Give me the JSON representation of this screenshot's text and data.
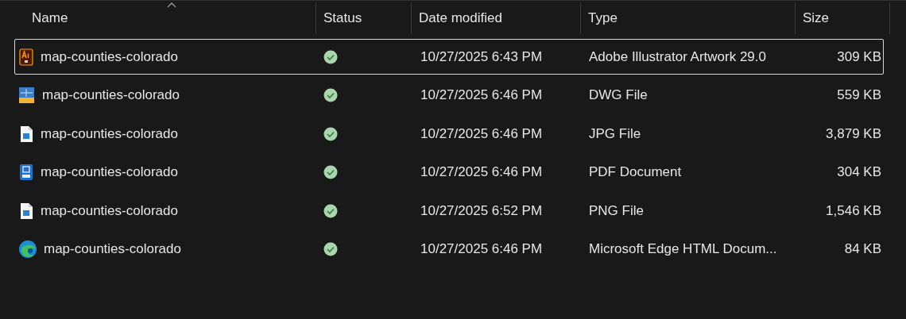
{
  "columns": [
    {
      "label": "Name",
      "sorted": true
    },
    {
      "label": "Status",
      "sorted": false
    },
    {
      "label": "Date modified",
      "sorted": false
    },
    {
      "label": "Type",
      "sorted": false
    },
    {
      "label": "Size",
      "sorted": false
    }
  ],
  "rows": [
    {
      "kind": "ai",
      "name": "map-counties-colorado",
      "synced": true,
      "date": "10/27/2025 6:43 PM",
      "type": "Adobe Illustrator Artwork 29.0",
      "size": "309 KB",
      "selected": true
    },
    {
      "kind": "dwg",
      "name": "map-counties-colorado",
      "synced": true,
      "date": "10/27/2025 6:46 PM",
      "type": "DWG File",
      "size": "559 KB",
      "selected": false
    },
    {
      "kind": "image",
      "name": "map-counties-colorado",
      "synced": true,
      "date": "10/27/2025 6:46 PM",
      "type": "JPG File",
      "size": "3,879 KB",
      "selected": false
    },
    {
      "kind": "pdf",
      "name": "map-counties-colorado",
      "synced": true,
      "date": "10/27/2025 6:46 PM",
      "type": "PDF Document",
      "size": "304 KB",
      "selected": false
    },
    {
      "kind": "image",
      "name": "map-counties-colorado",
      "synced": true,
      "date": "10/27/2025 6:52 PM",
      "type": "PNG File",
      "size": "1,546 KB",
      "selected": false
    },
    {
      "kind": "edge",
      "name": "map-counties-colorado",
      "synced": true,
      "date": "10/27/2025 6:46 PM",
      "type": "Microsoft Edge HTML Docum...",
      "size": "84 KB",
      "selected": false
    }
  ]
}
